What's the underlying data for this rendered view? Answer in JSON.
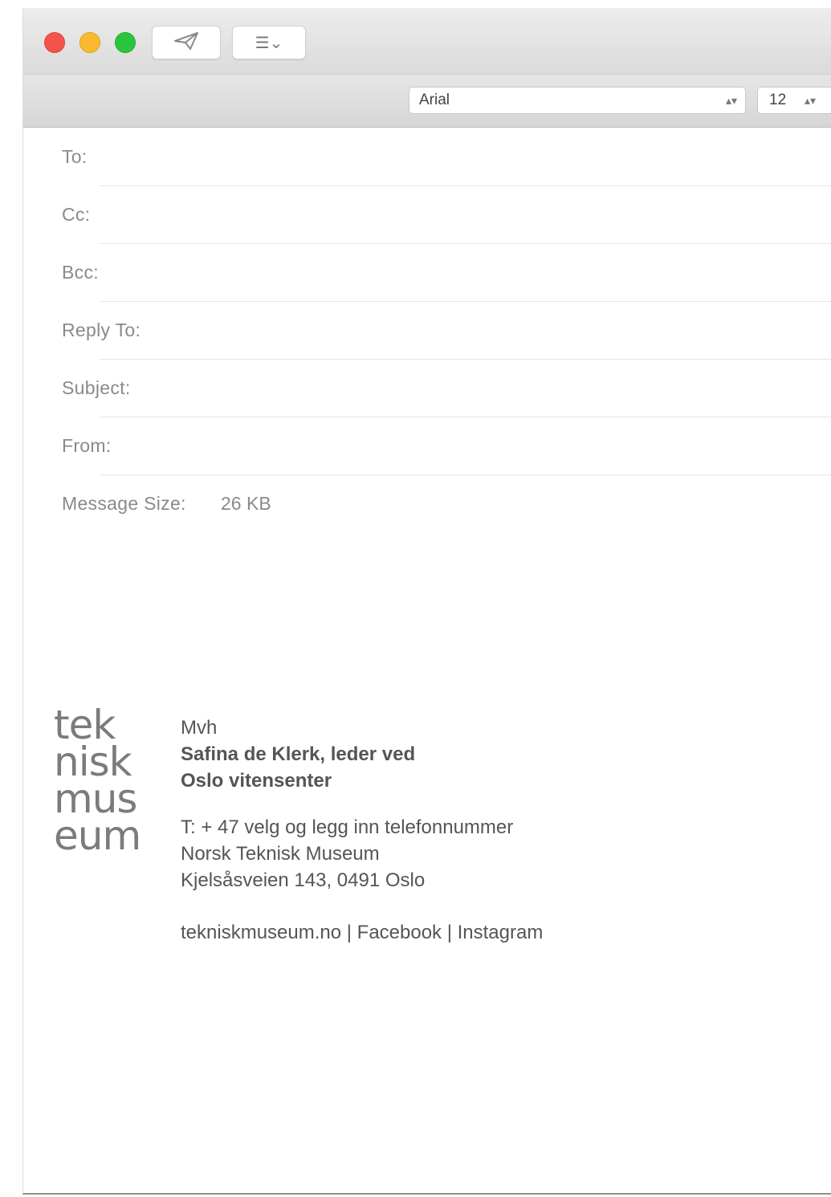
{
  "toolbar": {
    "send_icon": "paper-plane-icon",
    "format_icon": "list-dropdown-icon",
    "format_label": "☰⌄"
  },
  "formatbar": {
    "font": "Arial",
    "size": "12"
  },
  "headers": {
    "to": "To:",
    "cc": "Cc:",
    "bcc": "Bcc:",
    "reply_to": "Reply To:",
    "subject": "Subject:",
    "from": "From:",
    "message_size_label": "Message Size:",
    "message_size_value": "26 KB"
  },
  "signature": {
    "logo_lines": [
      "tek",
      "nisk",
      "mus",
      "eum"
    ],
    "greeting": "Mvh",
    "name_line1": "Safina de Klerk, leder ved",
    "name_line2": "Oslo vitensenter",
    "phone": "T: + 47 velg og legg inn telefonnummer",
    "org": "Norsk Teknisk Museum",
    "address": "Kjelsåsveien 143, 0491 Oslo",
    "links": "tekniskmuseum.no | Facebook | Instagram"
  }
}
